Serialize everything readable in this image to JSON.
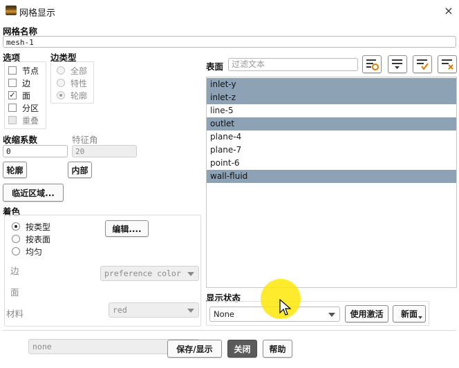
{
  "window": {
    "title": "网格显示",
    "close_glyph": "×"
  },
  "mesh_name": {
    "label": "网格名称",
    "value": "mesh-1"
  },
  "options": {
    "label": "选项",
    "items": [
      {
        "label": "节点",
        "checked": false,
        "disabled": false
      },
      {
        "label": "边",
        "checked": false,
        "disabled": false
      },
      {
        "label": "面",
        "checked": true,
        "disabled": false
      },
      {
        "label": "分区",
        "checked": false,
        "disabled": false
      },
      {
        "label": "重叠",
        "checked": false,
        "disabled": true
      }
    ]
  },
  "edge_type": {
    "label": "边类型",
    "items": [
      {
        "label": "全部",
        "selected": false
      },
      {
        "label": "特性",
        "selected": false
      },
      {
        "label": "轮廓",
        "selected": true
      }
    ]
  },
  "shrink": {
    "label": "收缩系数",
    "value": "0"
  },
  "feature_angle": {
    "label": "特征角",
    "value": "20"
  },
  "buttons": {
    "outline": "轮廓",
    "interior": "内部",
    "adjacent": "临近区域...",
    "edit": "编辑....",
    "save_display": "保存/显示",
    "close": "关闭",
    "help": "帮助",
    "use_active": "使用激活",
    "new_surface": "新面"
  },
  "coloring": {
    "label": "着色",
    "options": [
      {
        "label": "按类型",
        "selected": true
      },
      {
        "label": "按表面",
        "selected": false
      },
      {
        "label": "均匀",
        "selected": false
      }
    ],
    "edge": {
      "label": "边",
      "value": "preference color"
    },
    "face": {
      "label": "面",
      "value": "red"
    },
    "material": {
      "label": "材料",
      "value": "none"
    }
  },
  "surfaces": {
    "label": "表面",
    "filter_placeholder": "过滤文本",
    "items": [
      {
        "name": "inlet-y",
        "selected": true
      },
      {
        "name": "inlet-z",
        "selected": true
      },
      {
        "name": "line-5",
        "selected": false
      },
      {
        "name": "outlet",
        "selected": true
      },
      {
        "name": "plane-4",
        "selected": false
      },
      {
        "name": "plane-7",
        "selected": false
      },
      {
        "name": "point-6",
        "selected": false
      },
      {
        "name": "wall-fluid",
        "selected": true
      }
    ]
  },
  "display_state": {
    "label": "显示状态",
    "value": "None"
  },
  "colors": {
    "selected_row": "#8ea2b6",
    "accent_dark": "#5b5b5b",
    "cursor_highlight": "#ffe600"
  }
}
